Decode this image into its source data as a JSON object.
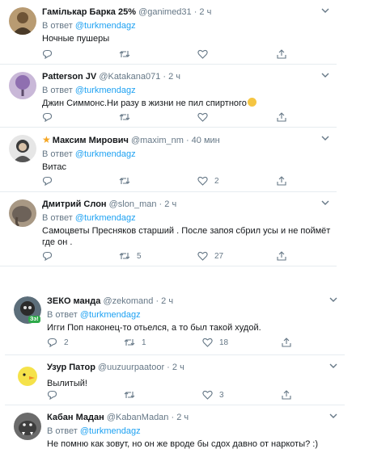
{
  "tweets": [
    {
      "name": "Гамількар Барка 25%",
      "handle": "@ganimed31 · 2 ч",
      "reply_prefix": "В ответ",
      "reply_to": "@turkmendagz",
      "text": "Ночные пушеры",
      "replies": "",
      "retweets": "",
      "likes": ""
    },
    {
      "name": "Patterson JV",
      "handle": "@Katakana071 · 2 ч",
      "reply_prefix": "В ответ",
      "reply_to": "@turkmendagz",
      "text": "Джин Симмонс.Ни разу в жизни не пил спиртного",
      "replies": "",
      "retweets": "",
      "likes": ""
    },
    {
      "name": "Максим Мирович",
      "handle": "@maxim_nm · 40 мин",
      "reply_prefix": "В ответ",
      "reply_to": "@turkmendagz",
      "text": "Витас",
      "replies": "",
      "retweets": "",
      "likes": "2"
    },
    {
      "name": "Дмитрий Слон",
      "handle": "@slon_man · 2 ч",
      "reply_prefix": "В ответ",
      "reply_to": "@turkmendagz",
      "text": "Самоцветы Пресняков старший . После запоя сбрил усы и не поймёт где он .",
      "replies": "",
      "retweets": "5",
      "likes": "27"
    },
    {
      "name": "ЗЕКО манда",
      "handle": "@zekomand · 2 ч",
      "reply_prefix": "В ответ",
      "reply_to": "@turkmendagz",
      "text": "Игги Поп наконец-то отьелся, а то был такой худой.",
      "replies": "2",
      "retweets": "1",
      "likes": "18"
    },
    {
      "name": "Узур Патор",
      "handle": "@uuzuurpaatoor · 2 ч",
      "reply_prefix": "",
      "reply_to": "",
      "text": "Вылитый!",
      "replies": "",
      "retweets": "",
      "likes": "3"
    },
    {
      "name": "Кабан Мадан",
      "handle": "@KabanMadan · 2 ч",
      "reply_prefix": "В ответ",
      "reply_to": "@turkmendagz",
      "text": "Не помню как зовут, но он же вроде бы сдох давно от наркоты? :)",
      "replies": "",
      "retweets": "",
      "likes": ""
    }
  ],
  "badges": {
    "avatar_zeko_badge": "Зэ!"
  },
  "colors": {
    "accent": "#1da1f2",
    "muted": "#657786",
    "star": "#f5a623"
  }
}
